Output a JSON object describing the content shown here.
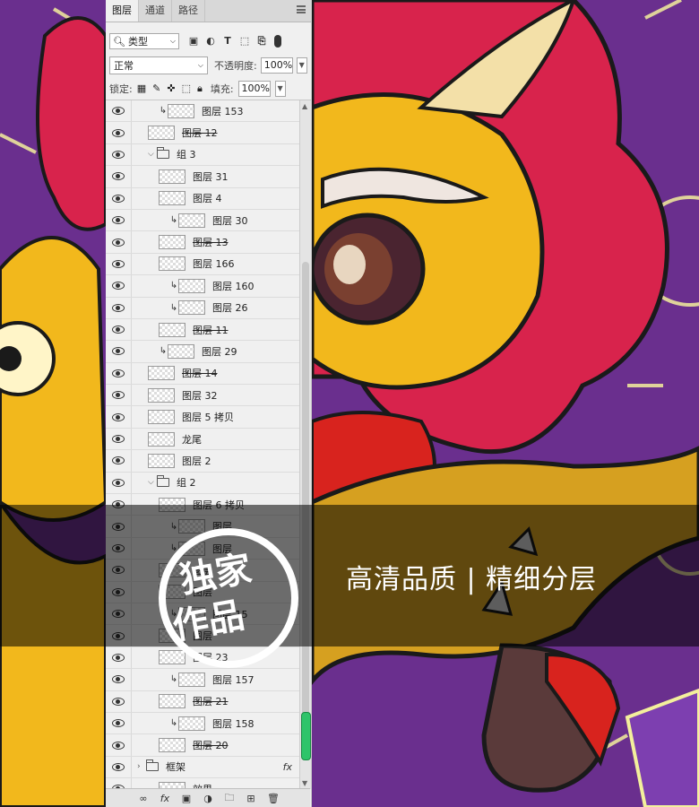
{
  "panel": {
    "tabs": [
      "图层",
      "通道",
      "路径"
    ],
    "filter_label": "类型",
    "blend_mode": "正常",
    "opacity_label": "不透明度:",
    "opacity_value": "100%",
    "lock_label": "锁定:",
    "fill_label": "填充:",
    "fill_value": "100%",
    "layers": [
      {
        "name": "图层 153",
        "clip": true,
        "indent": 2,
        "strike": false
      },
      {
        "name": "图层 12",
        "clip": false,
        "indent": 1,
        "strike": true
      },
      {
        "name": "组 3",
        "group": true,
        "indent": 1
      },
      {
        "name": "图层 31",
        "clip": false,
        "indent": 2,
        "strike": false
      },
      {
        "name": "图层 4",
        "clip": false,
        "indent": 2,
        "strike": false
      },
      {
        "name": "图层 30",
        "clip": true,
        "indent": 3,
        "strike": false
      },
      {
        "name": "图层 13",
        "clip": false,
        "indent": 2,
        "strike": true
      },
      {
        "name": "图层 166",
        "clip": false,
        "indent": 2,
        "strike": false
      },
      {
        "name": "图层 160",
        "clip": true,
        "indent": 3,
        "strike": false
      },
      {
        "name": "图层 26",
        "clip": true,
        "indent": 3,
        "strike": false
      },
      {
        "name": "图层 11",
        "clip": false,
        "indent": 2,
        "strike": true
      },
      {
        "name": "图层 29",
        "clip": true,
        "indent": 2,
        "strike": false
      },
      {
        "name": "图层 14",
        "clip": false,
        "indent": 1,
        "strike": true
      },
      {
        "name": "图层 32",
        "clip": false,
        "indent": 1,
        "strike": false
      },
      {
        "name": "图层 5 拷贝",
        "clip": false,
        "indent": 1,
        "strike": false
      },
      {
        "name": "龙尾",
        "clip": false,
        "indent": 1,
        "strike": false
      },
      {
        "name": "图层 2",
        "clip": false,
        "indent": 1,
        "strike": false
      },
      {
        "name": "组 2",
        "group": true,
        "indent": 1
      },
      {
        "name": "图层 6 拷贝",
        "clip": false,
        "indent": 2,
        "strike": false
      },
      {
        "name": "图层",
        "clip": true,
        "indent": 3,
        "strike": false
      },
      {
        "name": "图层",
        "clip": true,
        "indent": 3,
        "strike": false
      },
      {
        "name": "图层",
        "clip": false,
        "indent": 2,
        "strike": false
      },
      {
        "name": "图层",
        "clip": false,
        "indent": 2,
        "strike": false
      },
      {
        "name": "图层 15",
        "clip": true,
        "indent": 3,
        "strike": false
      },
      {
        "name": "图层",
        "clip": false,
        "indent": 2,
        "strike": false
      },
      {
        "name": "图层 23",
        "clip": false,
        "indent": 2,
        "strike": false
      },
      {
        "name": "图层 157",
        "clip": true,
        "indent": 3,
        "strike": false
      },
      {
        "name": "图层 21",
        "clip": false,
        "indent": 2,
        "strike": true
      },
      {
        "name": "图层 158",
        "clip": true,
        "indent": 3,
        "strike": false
      },
      {
        "name": "图层 20",
        "clip": false,
        "indent": 2,
        "strike": true
      },
      {
        "name": "框架",
        "group": true,
        "collapsed": true,
        "indent": 0,
        "fx": "fx"
      },
      {
        "name": "效果",
        "clip": false,
        "indent": 2,
        "strike": false
      }
    ]
  },
  "banner": {
    "text": "高清品质 | 精细分层",
    "stamp_line1": "独家",
    "stamp_line2": "作品"
  },
  "colors": {
    "background_purple": "#6a2f8e",
    "dragon_yellow": "#f2b81c",
    "mane_red": "#d8234c",
    "glow_yellow": "#f3ef9c"
  }
}
